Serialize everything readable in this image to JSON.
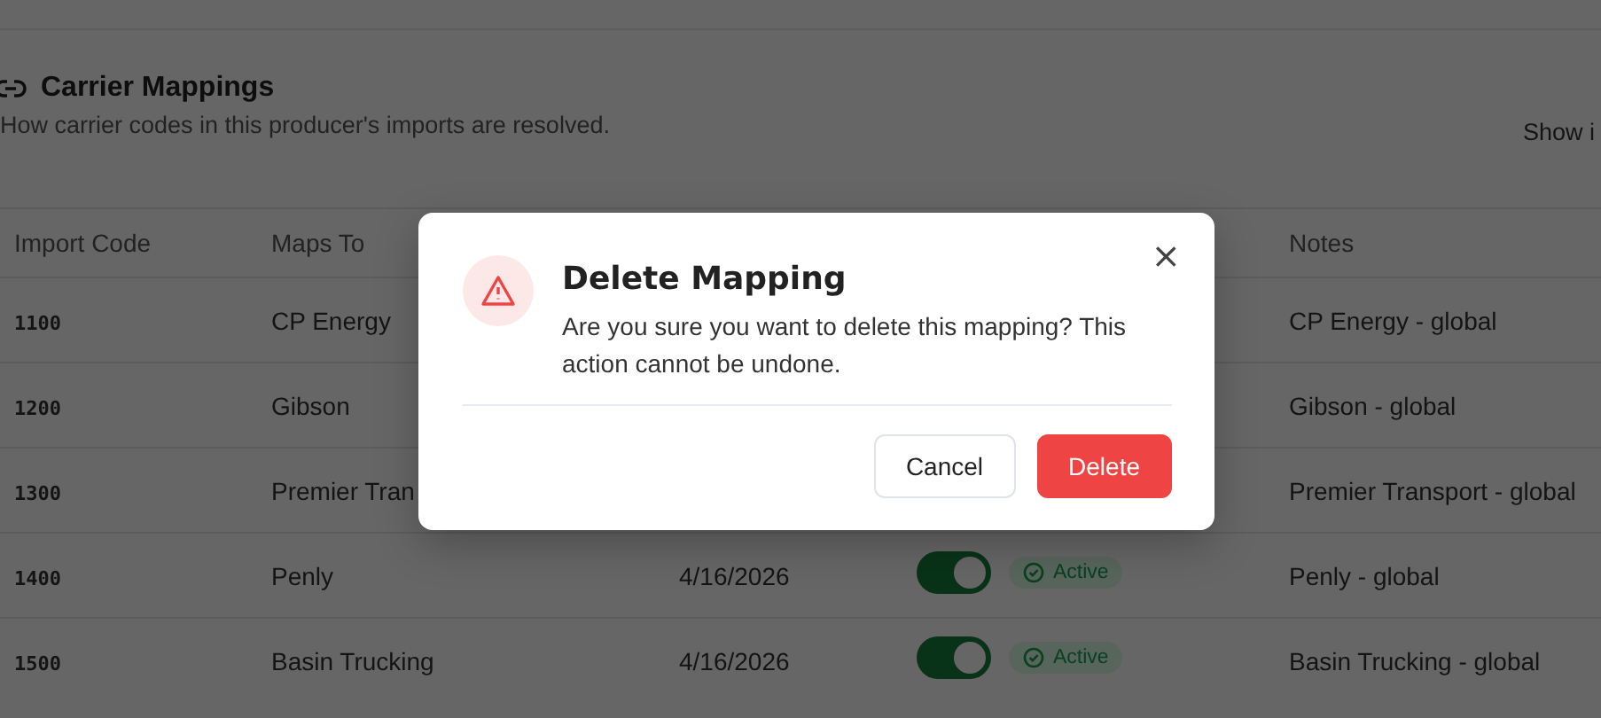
{
  "section": {
    "title": "Carrier Mappings",
    "subtitle": "How carrier codes in this producer's imports are resolved.",
    "show_toggle_label": "Show i"
  },
  "table": {
    "columns": [
      "Import Code",
      "Maps To",
      "Notes"
    ],
    "rows": [
      {
        "code": "1100",
        "maps_to": "CP Energy",
        "notes": "CP Energy - global"
      },
      {
        "code": "1200",
        "maps_to": "Gibson",
        "notes": "Gibson - global"
      },
      {
        "code": "1300",
        "maps_to": "Premier Tran",
        "notes": "Premier Transport - global"
      },
      {
        "code": "1400",
        "maps_to": "Penly",
        "date": "4/16/2026",
        "on": true,
        "status": "Active",
        "notes": "Penly - global"
      },
      {
        "code": "1500",
        "maps_to": "Basin Trucking",
        "date": "4/16/2026",
        "on": true,
        "status": "Active",
        "notes": "Basin Trucking - global"
      }
    ]
  },
  "dialog": {
    "title": "Delete Mapping",
    "message": "Are you sure you want to delete this mapping? This action cannot be undone.",
    "close": "×",
    "buttons": [
      {
        "label": "Cancel",
        "kind": "secondary"
      },
      {
        "label": "Delete",
        "kind": "danger"
      }
    ]
  }
}
